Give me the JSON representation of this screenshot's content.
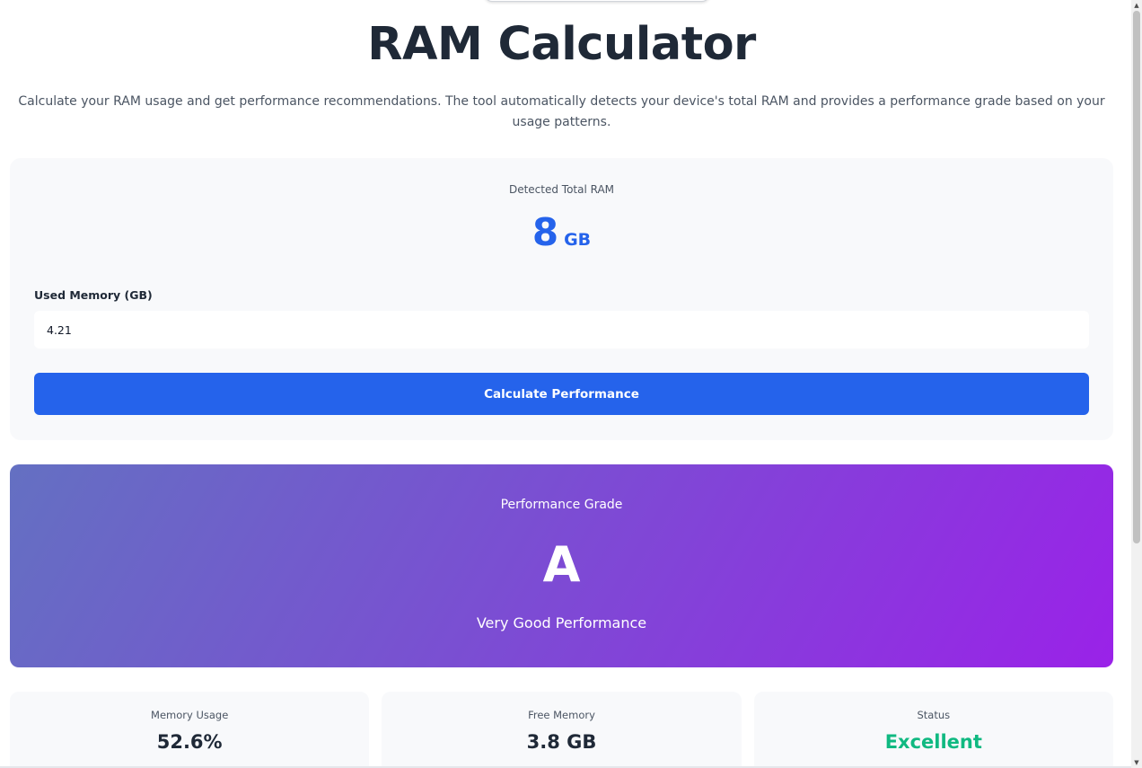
{
  "header": {
    "title": "RAM Calculator",
    "description": "Calculate your RAM usage and get performance recommendations. The tool automatically detects your device's total RAM and provides a performance grade based on your usage patterns."
  },
  "calculator": {
    "detected_label": "Detected Total RAM",
    "ram_value": "8",
    "ram_unit": "GB",
    "used_label": "Used Memory (GB)",
    "used_value": "4.21",
    "button_label": "Calculate Performance"
  },
  "grade": {
    "label": "Performance Grade",
    "letter": "A",
    "description": "Very Good Performance"
  },
  "stats": [
    {
      "label": "Memory Usage",
      "value": "52.6%"
    },
    {
      "label": "Free Memory",
      "value": "3.8 GB"
    },
    {
      "label": "Status",
      "value": "Excellent"
    }
  ],
  "colors": {
    "accent": "#2563eb",
    "status_good": "#10b981",
    "grade_gradient_start": "#6470c2",
    "grade_gradient_end": "#9a22e8"
  },
  "icons": {
    "scroll_up": "triangle-up-icon",
    "scroll_down": "triangle-down-icon"
  }
}
